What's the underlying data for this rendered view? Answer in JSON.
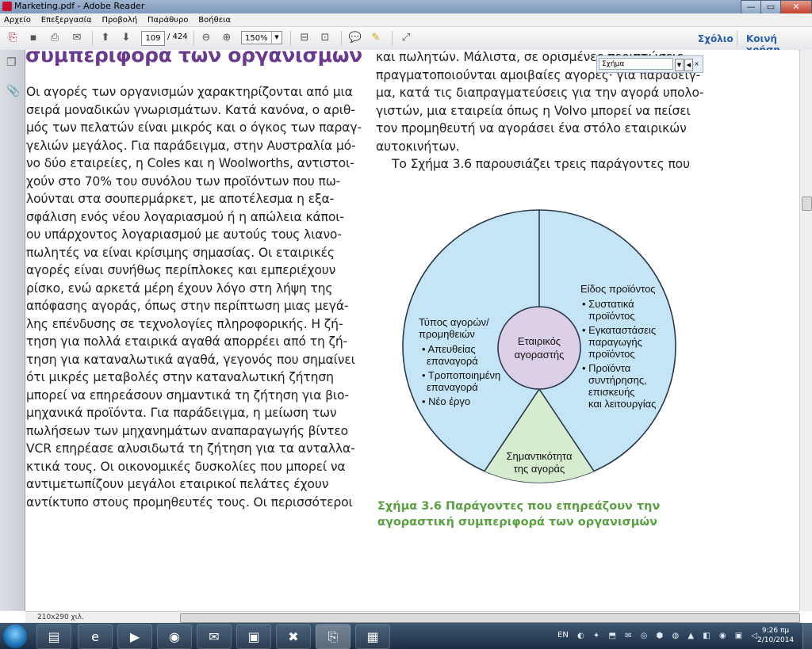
{
  "window": {
    "title": "Marketing.pdf - Adobe Reader",
    "min": "—",
    "max": "▭",
    "close": "✕"
  },
  "menu": [
    "Αρχείο",
    "Επεξεργασία",
    "Προβολή",
    "Παράθυρο",
    "Βοήθεια"
  ],
  "toolbar": {
    "page_current": "109",
    "page_total": "/ 424",
    "zoom": "150%",
    "comment_label": "Σχόλιο",
    "share_label": "Κοινή χρήση"
  },
  "findbox": {
    "value": "Σχήμα"
  },
  "document": {
    "heading": "συμπεριφορά των οργανισμών",
    "left_lines": [
      "Οι αγορές των οργανισμών χαρακτηρίζονται από μια",
      "σειρά μοναδικών γνωρισμάτων. Κατά κανόνα, ο αριθ-",
      "μός των πελατών είναι μικρός και ο όγκος των παραγ-",
      "γελιών μεγάλος. Για παράδειγμα, στην Αυστραλία μό-",
      "νο δύο εταιρείες, η Coles και η Woolworths, αντιστοι-",
      "χούν στο 70% του συνόλου των προϊόντων που πω-",
      "λούνται στα σουπερμάρκετ, με αποτέλεσμα η εξα-",
      "σφάλιση ενός νέου λογαριασμού ή η απώλεια κάποι-",
      "ου υπάρχοντος λογαριασμού με αυτούς τους λιανο-",
      "πωλητές να είναι κρίσιμης σημασίας. Οι εταιρικές",
      "αγορές είναι συνήθως περίπλοκες και εμπεριέχουν",
      "ρίσκο, ενώ αρκετά μέρη έχουν λόγο στη λήψη της",
      "απόφασης αγοράς, όπως στην περίπτωση μιας μεγά-",
      "λης επένδυσης σε τεχνολογίες πληροφορικής. Η ζή-",
      "τηση για πολλά εταιρικά αγαθά απορρέει από τη ζή-",
      "τηση για καταναλωτικά αγαθά, γεγονός που σημαίνει",
      "ότι μικρές μεταβολές στην καταναλωτική ζήτηση",
      "μπορεί να επηρεάσουν σημαντικά τη ζήτηση για βιο-",
      "μηχανικά προϊόντα. Για παράδειγμα, η μείωση των",
      "πωλήσεων των μηχανημάτων αναπαραγωγής βίντεο",
      "VCR επηρέασε αλυσιδωτά τη ζήτηση για τα ανταλλα-",
      "κτικά τους. Οι οικονομικές δυσκολίες που μπορεί να",
      "αντιμετωπίζουν μεγάλοι εταιρικοί πελάτες έχουν",
      "αντίκτυπο στους προμηθευτές τους. Οι περισσότεροι"
    ],
    "right_lines": [
      "και πωλητών. Μάλιστα, σε ορισμένες περιπτώσεις",
      "πραγματοποιούνται αμοιβαίες αγορές· για παράδειγ-",
      "μα, κατά τις διαπραγματεύσεις για την αγορά υπολο-",
      "γιστών, μια εταιρεία όπως η Volvo μπορεί να πείσει",
      "τον προμηθευτή να αγοράσει ένα στόλο εταιρικών",
      "αυτοκινήτων."
    ],
    "right_para2": "Το Σχήμα 3.6 παρουσιάζει τρεις παράγοντες που",
    "figure": {
      "center": [
        "Εταιρικός",
        "αγοραστής"
      ],
      "left_title": [
        "Τύπος αγορών/",
        "προμηθειών"
      ],
      "left_items": [
        "• Απευθείας",
        "  επαναγορά",
        "• Τροποποιημένη",
        "  επαναγορά",
        "• Νέο έργο"
      ],
      "right_title": "Είδος προϊόντος",
      "right_items": [
        "• Συστατικά",
        "  προϊόντος",
        "• Εγκαταστάσεις",
        "  παραγωγής",
        "  προϊόντος",
        "• Προϊόντα",
        "  συντήρησης,",
        "  επισκευής",
        "  και λειτουργίας"
      ],
      "bottom": [
        "Σημαντικότητα",
        "της αγοράς"
      ],
      "colors": {
        "outer": "#c5e4f6",
        "center": "#dcd0e8",
        "triangle": "#d7eccf",
        "stroke": "#2b3a4a"
      }
    },
    "caption_line1": "Σχήμα 3.6  Παράγοντες που επηρεάζουν την",
    "caption_line2": "αγοραστική συμπεριφορά των οργανισμών"
  },
  "status": {
    "page_size": "210x290 χιλ."
  },
  "taskbar": {
    "lang": "EN",
    "time": "9:26 πμ",
    "date": "2/10/2014"
  }
}
